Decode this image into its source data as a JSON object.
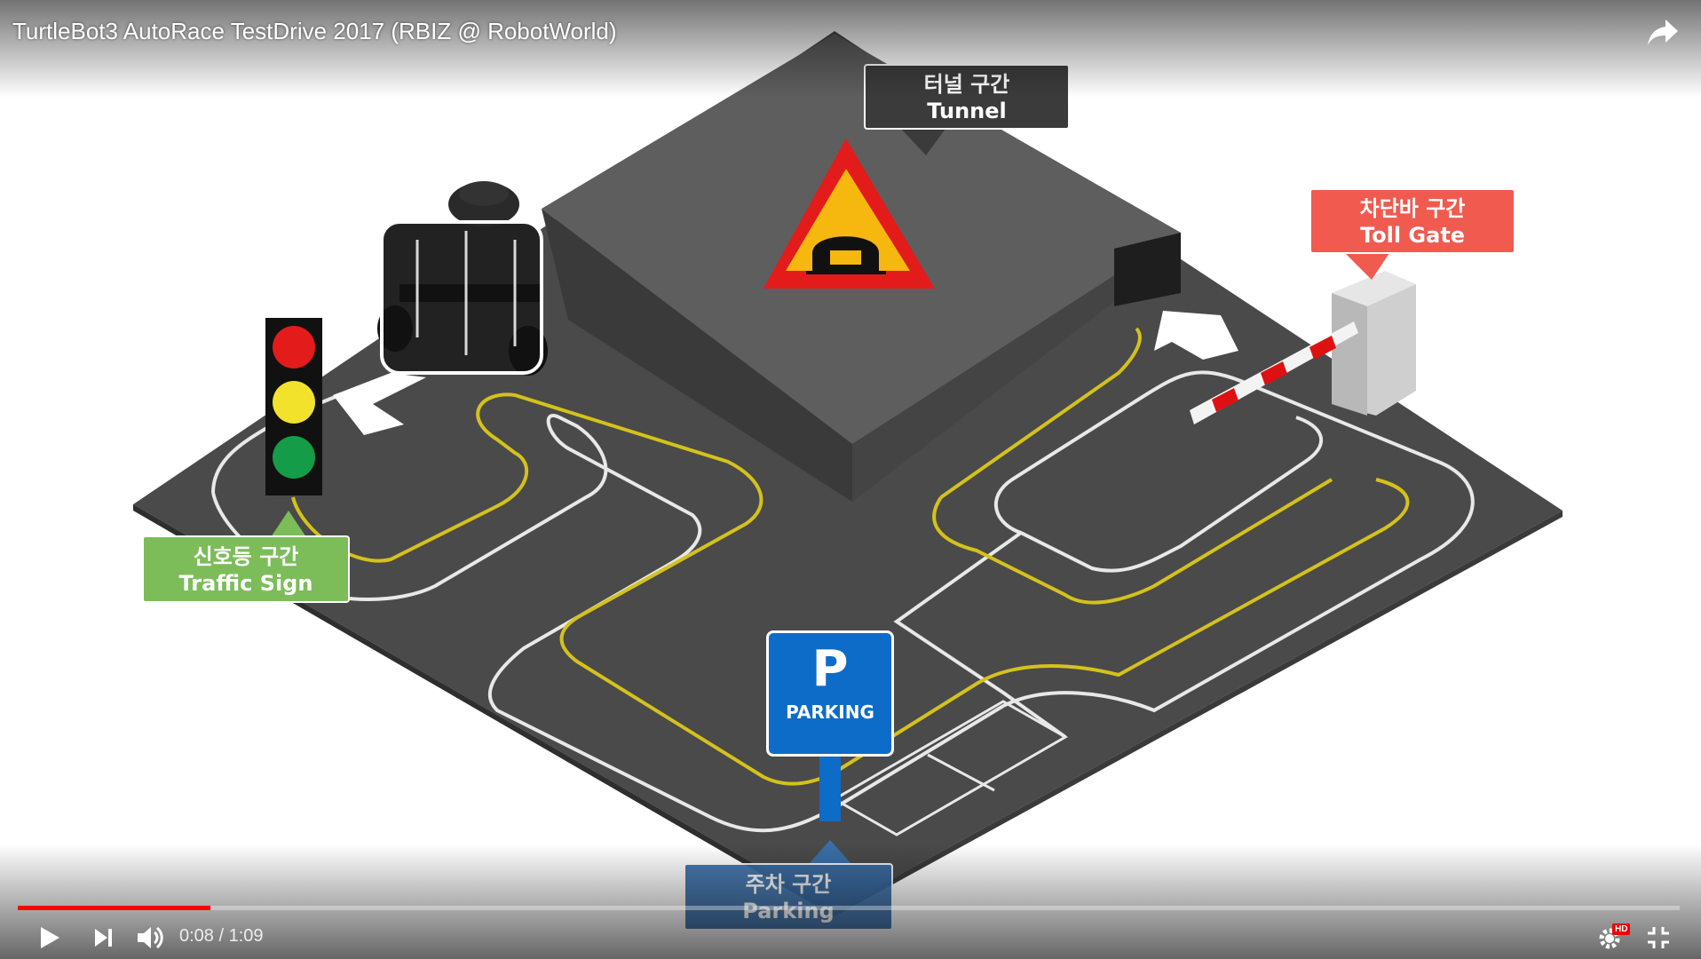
{
  "video": {
    "title": "TurtleBot3 AutoRace TestDrive 2017 (RBIZ @ RobotWorld)",
    "time_current": "0:08",
    "time_separator": "/",
    "time_total": "1:09",
    "progress_fraction": 0.116
  },
  "labels": {
    "tunnel": {
      "ko": "터널 구간",
      "en": "Tunnel"
    },
    "toll_gate": {
      "ko": "차단바 구간",
      "en": "Toll Gate"
    },
    "traffic_sign": {
      "ko": "신호등 구간",
      "en": "Traffic Sign"
    },
    "parking_zone": {
      "ko": "주차 구간",
      "en": "Parking"
    }
  },
  "parking_sign": {
    "letter": "P",
    "text": "PARKING"
  },
  "badges": {
    "hd": "HD"
  },
  "colors": {
    "progress": "#ff0000",
    "tunnel_label": "#3b3b3b",
    "toll_label": "#f05a4f",
    "traffic_label": "#7cbd5a",
    "parking_label": "#3a6ea8",
    "parking_sign": "#0d6cc7"
  },
  "icons": {
    "share": "share-icon",
    "play": "play-icon",
    "next": "next-icon",
    "volume": "volume-icon",
    "settings": "gear-icon",
    "exit_fullscreen": "exit-fullscreen-icon"
  }
}
